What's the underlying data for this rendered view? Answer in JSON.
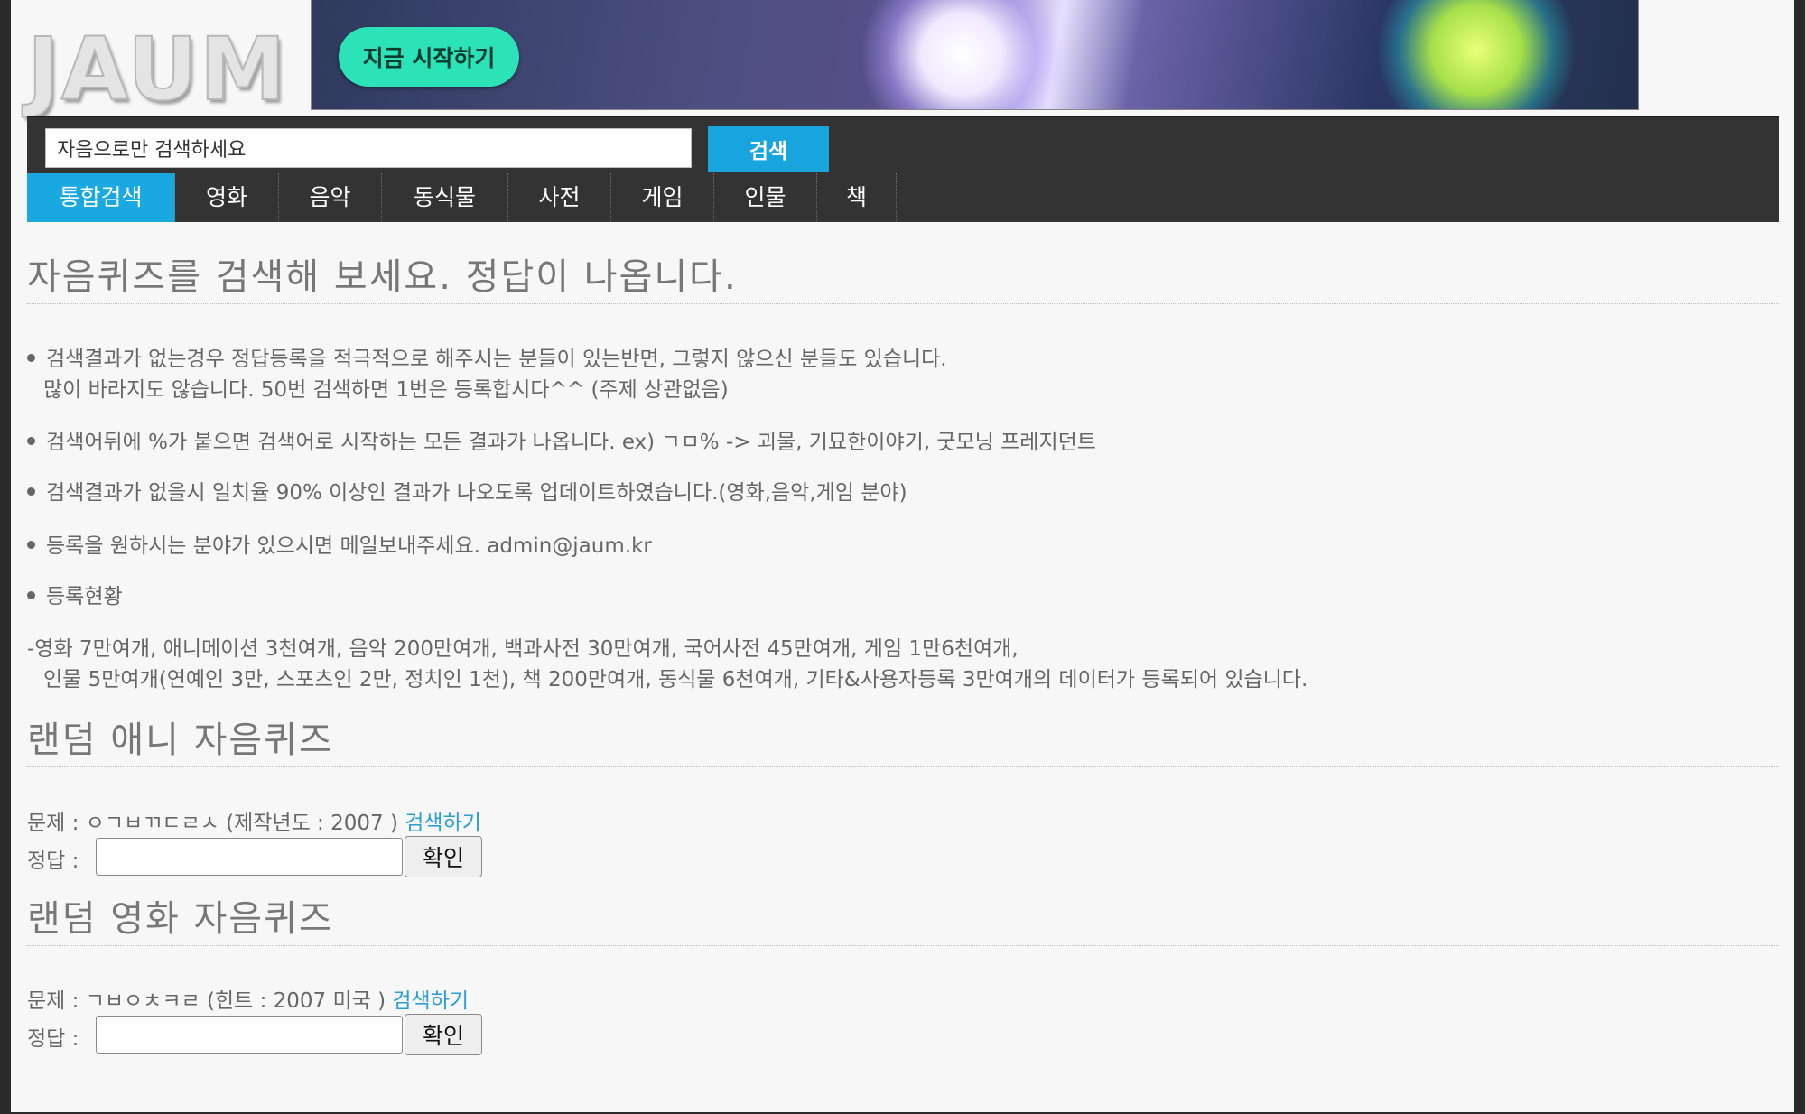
{
  "header": {
    "logo_text": "JAUM",
    "banner_cta": "지금 시작하기"
  },
  "search": {
    "value": "자음으로만 검색하세요",
    "button_label": "검색"
  },
  "tabs": [
    {
      "label": "통합검색",
      "active": true
    },
    {
      "label": "영화"
    },
    {
      "label": "음악"
    },
    {
      "label": "동식물"
    },
    {
      "label": "사전"
    },
    {
      "label": "게임"
    },
    {
      "label": "인물"
    },
    {
      "label": "책"
    }
  ],
  "intro": {
    "title": "자음퀴즈를 검색해 보세요. 정답이 나옵니다.",
    "bullet1_line1": "검색결과가 없는경우 정답등록을 적극적으로 해주시는 분들이 있는반면, 그렇지 않으신 분들도 있습니다.",
    "bullet1_line2": "많이 바라지도 않습니다. 50번 검색하면 1번은 등록합시다^^ (주제 상관없음)",
    "bullet2": "검색어뒤에 %가 붙으면 검색어로 시작하는 모든 결과가 나옵니다. ex) ㄱㅁ% -> 괴물, 기묘한이야기, 굿모닝 프레지던트",
    "bullet3": "검색결과가 없을시 일치율 90% 이상인 결과가 나오도록 업데이트하였습니다.(영화,음악,게임 분야)",
    "bullet4": "등록을 원하시는 분야가 있으시면 메일보내주세요. admin@jaum.kr",
    "bullet5": "등록현황",
    "stats_line1": "-영화 7만여개, 애니메이션 3천여개, 음악 200만여개, 백과사전 30만여개, 국어사전 45만여개, 게임 1만6천여개,",
    "stats_line2": "인물 5만여개(연예인 3만, 스포츠인 2만, 정치인 1천), 책 200만여개, 동식물 6천여개, 기타&사용자등록 3만여개의 데이터가 등록되어 있습니다."
  },
  "quiz_anime": {
    "title": "랜덤 애니 자음퀴즈",
    "question": "문제 : ㅇㄱㅂㄲㄷㄹㅅ (제작년도 : 2007 )",
    "search_link": "검색하기",
    "answer_label": "정답 :",
    "answer_value": "",
    "confirm_label": "확인"
  },
  "quiz_movie": {
    "title": "랜덤 영화 자음퀴즈",
    "question": "문제 : ㄱㅂㅇㅊㅋㄹ (힌트 : 2007 미국 )",
    "search_link": "검색하기",
    "answer_label": "정답 :",
    "answer_value": "",
    "confirm_label": "확인"
  },
  "colors": {
    "accent": "#1aa8e0",
    "panel": "#333333",
    "banner_button": "#2be3b6",
    "link": "#2a9fd6"
  }
}
